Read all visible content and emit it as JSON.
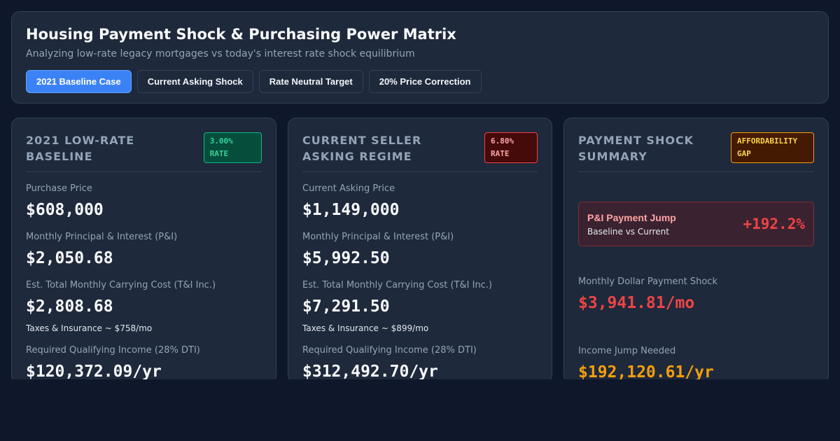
{
  "header": {
    "title": "Housing Payment Shock & Purchasing Power Matrix",
    "subtitle": "Analyzing low-rate legacy mortgages vs today's interest rate shock equilibrium",
    "buttons": [
      {
        "label": "2021 Baseline Case",
        "active": true
      },
      {
        "label": "Current Asking Shock",
        "active": false
      },
      {
        "label": "Rate Neutral Target",
        "active": false
      },
      {
        "label": "20% Price Correction",
        "active": false
      }
    ]
  },
  "baseline": {
    "title": "2021 Low-Rate Baseline",
    "badge": "3.00% RATE",
    "purchase_label": "Purchase Price",
    "purchase_value": "$608,000",
    "pi_label": "Monthly Principal & Interest (P&I)",
    "pi_value": "$2,050.68",
    "total_label": "Est. Total Monthly Carrying Cost (T&I Inc.)",
    "total_value": "$2,808.68",
    "total_note": "Taxes & Insurance ~ $758/mo",
    "income_label": "Required Qualifying Income (28% DTI)",
    "income_value": "$120,372.09/yr"
  },
  "current": {
    "title": "Current Seller Asking Regime",
    "badge": "6.80% RATE",
    "purchase_label": "Current Asking Price",
    "purchase_value": "$1,149,000",
    "pi_label": "Monthly Principal & Interest (P&I)",
    "pi_value": "$5,992.50",
    "total_label": "Est. Total Monthly Carrying Cost (T&I Inc.)",
    "total_value": "$7,291.50",
    "total_note": "Taxes & Insurance ~ $899/mo",
    "income_label": "Required Qualifying Income (28% DTI)",
    "income_value": "$312,492.70/yr"
  },
  "summary": {
    "title": "Payment Shock Summary",
    "badge": "AFFORDABILITY GAP",
    "jump_title": "P&I Payment Jump",
    "jump_sub": "Baseline vs Current",
    "jump_value": "+192.2%",
    "shock_label": "Monthly Dollar Payment Shock",
    "shock_value": "$3,941.81/mo",
    "income_label": "Income Jump Needed",
    "income_value": "$192,120.61/yr"
  },
  "colors": {
    "background": "#0f172a",
    "card": "#1e293b",
    "accent": "#3b82f6",
    "positive": "#10b981",
    "negative": "#ef4444",
    "warning": "#f59e0b"
  }
}
